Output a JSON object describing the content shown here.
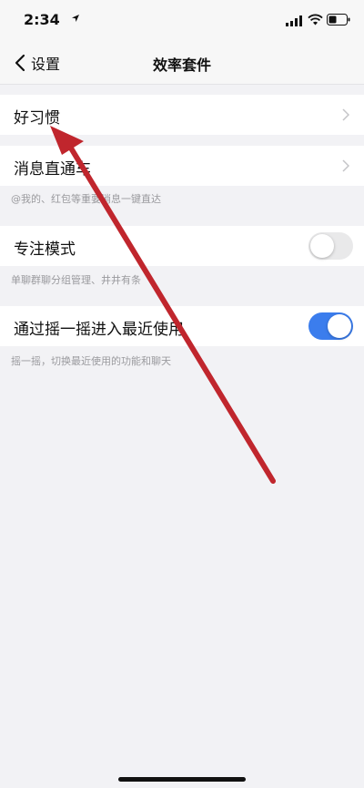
{
  "status_bar": {
    "time": "2:34",
    "icons": [
      "location-arrow-icon",
      "signal-icon",
      "wifi-icon",
      "battery-icon"
    ]
  },
  "nav": {
    "back_label": "设置",
    "title": "效率套件"
  },
  "rows": [
    {
      "label": "好习惯",
      "control": "chevron"
    },
    {
      "label": "消息直通车",
      "control": "chevron",
      "hint": "@我的、红包等重要消息一键直达"
    },
    {
      "label": "专注模式",
      "control": "switch",
      "on": false,
      "hint": "单聊群聊分组管理、井井有条"
    },
    {
      "label": "通过摇一摇进入最近使用",
      "control": "switch",
      "on": true,
      "hint": "摇一摇，切换最近使用的功能和聊天"
    }
  ],
  "colors": {
    "background": "#f2f2f5",
    "switch_on": "#3b7ded",
    "switch_off": "#e9e9ea",
    "annotation_arrow": "#c0262d"
  }
}
